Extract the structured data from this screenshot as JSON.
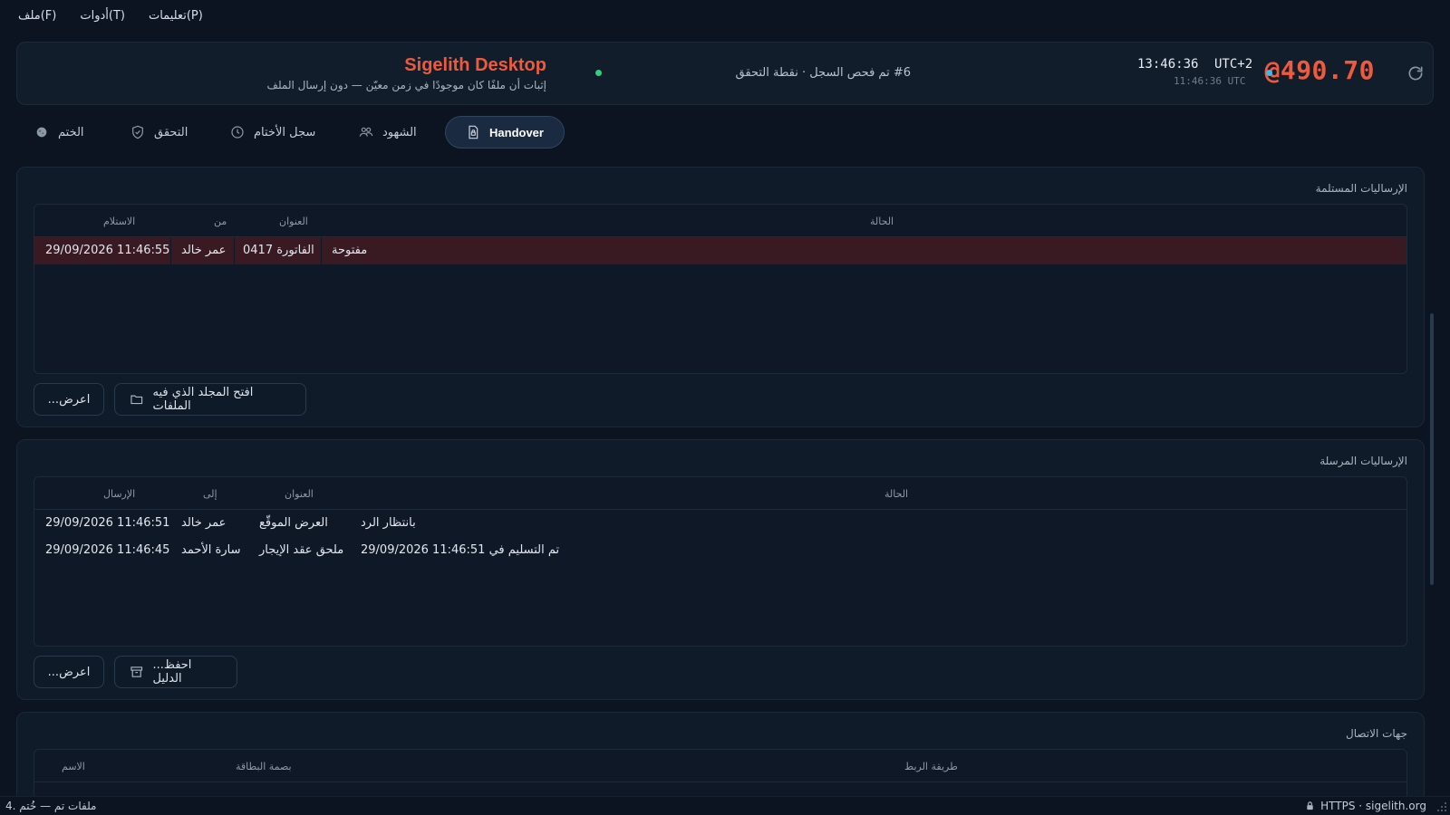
{
  "menu": {
    "file": "ملف(F)",
    "tools": "أدوات(T)",
    "help": "تعليمات(P)"
  },
  "header": {
    "counter": "@490.70",
    "clock_local": "13:46:36",
    "clock_tz": "UTC+2",
    "clock_utc": "11:46:36 UTC",
    "check_note": "#6 تم فحص السجل · نقطة التحقق",
    "app_title": "Sigelith Desktop",
    "app_subtitle": "إثبات أن ملفًا كان موجودًا في زمن معيّن — دون إرسال الملف"
  },
  "tabs": [
    {
      "label": "Handover",
      "icon": "file-lock-icon",
      "active": true
    },
    {
      "label": "الشهود",
      "icon": "users-icon",
      "active": false
    },
    {
      "label": "سجل الأختام",
      "icon": "clock-icon",
      "active": false
    },
    {
      "label": "التحقق",
      "icon": "shield-check-icon",
      "active": false
    },
    {
      "label": "الختم",
      "icon": "seal-icon",
      "active": false
    }
  ],
  "received": {
    "title": "الإرساليات المستلمة",
    "columns": {
      "received": "الاستلام",
      "from": "من",
      "subject": "العنوان",
      "status": "الحالة"
    },
    "rows": [
      {
        "received": "29/09/2026 11:46:55",
        "from": "عمر خالد",
        "subject": "الفاتورة 0417",
        "status": "مفتوحة",
        "selected": true
      }
    ],
    "view_button": "...اعرض",
    "open_folder_button": "افتح المجلد الذي فيه الملفات"
  },
  "sent": {
    "title": "الإرساليات المرسلة",
    "columns": {
      "sent": "الإرسال",
      "to": "إلى",
      "subject": "العنوان",
      "status": "الحالة"
    },
    "rows": [
      {
        "sent": "29/09/2026 11:46:51",
        "to": "عمر خالد",
        "subject": "العرض الموقّع",
        "status": "بانتظار الرد"
      },
      {
        "sent": "29/09/2026 11:46:45",
        "to": "سارة الأحمد",
        "subject": "ملحق عقد الإيجار",
        "status": "29/09/2026 11:46:51 تم التسليم في"
      }
    ],
    "view_button": "...اعرض",
    "save_proof_button": "...احفظ الدليل"
  },
  "contacts": {
    "title": "جهات الاتصال",
    "columns": {
      "name": "الاسم",
      "fingerprint": "بصمة البطاقة",
      "link_method": "طريقة الربط"
    }
  },
  "statusbar": {
    "left": "4. ملفات تم — خُتم",
    "right": "HTTPS · sigelith.org"
  },
  "colors": {
    "accent": "#ef5a3c",
    "background": "#0b1420",
    "card": "#101b29",
    "selected_row": "#3a1a22",
    "online_dot": "#2fd17a",
    "clock_dot": "#3fb8e6"
  }
}
